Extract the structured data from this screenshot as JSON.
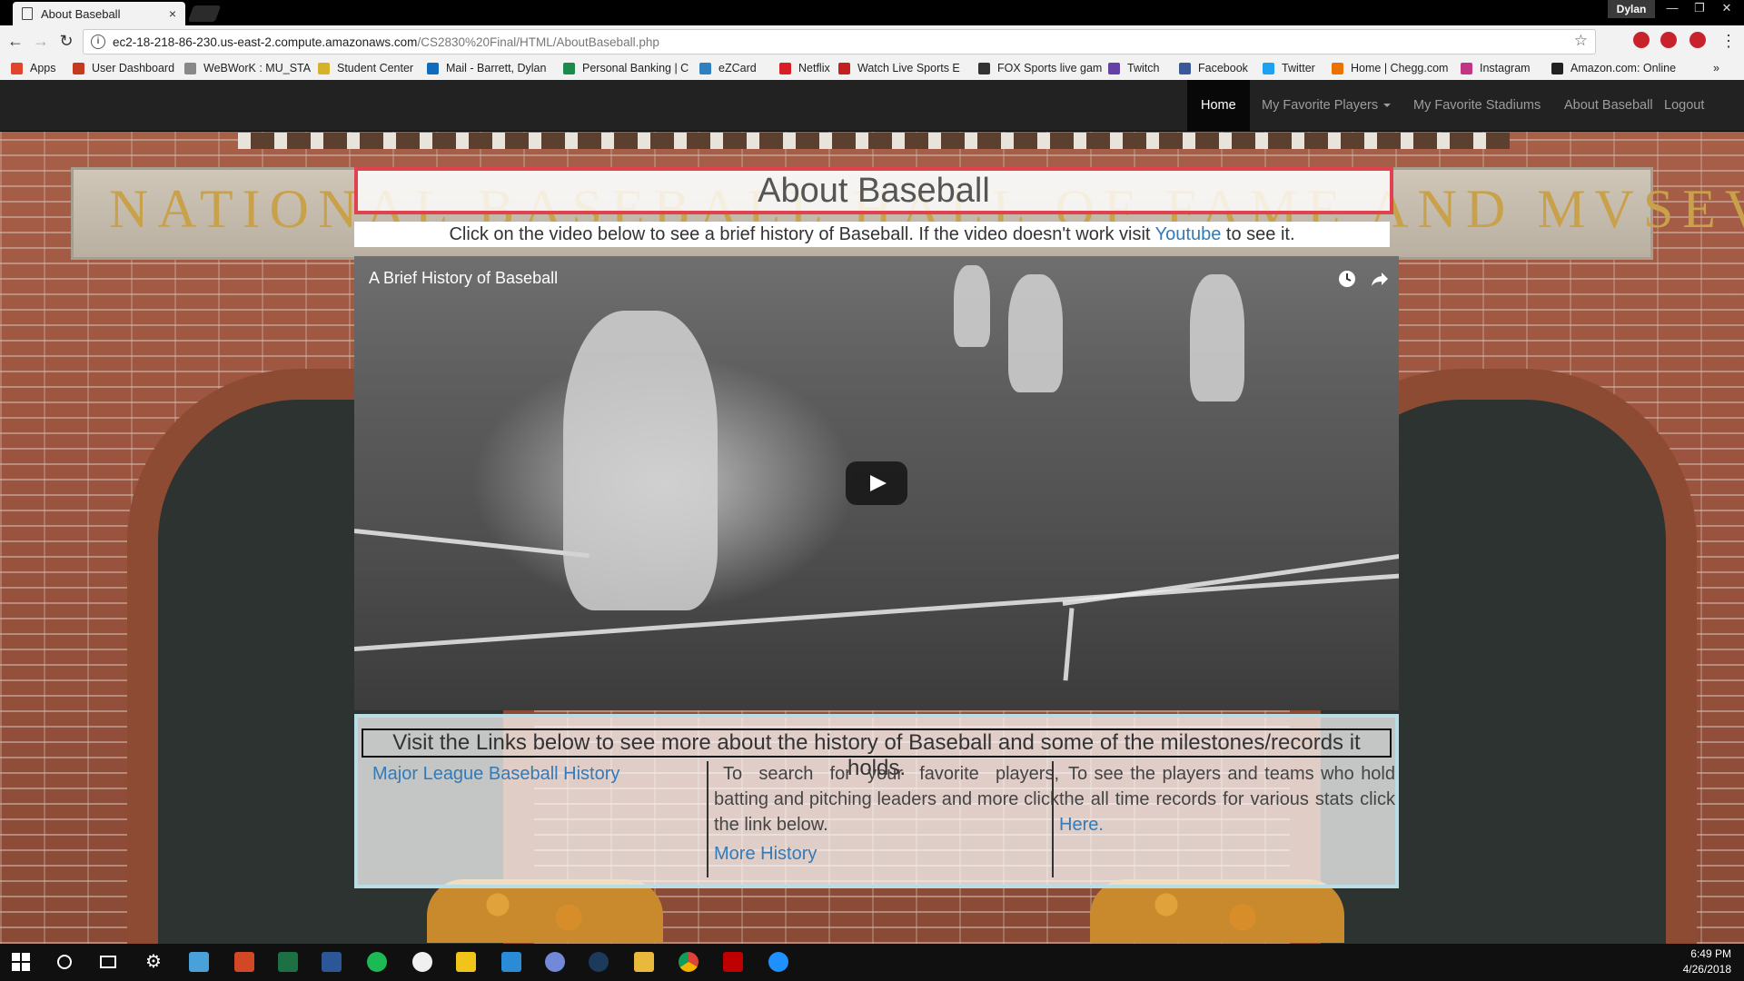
{
  "browser": {
    "tab_title": "About Baseball",
    "tab_close": "×",
    "user": "Dylan",
    "url_host": "ec2-18-218-86-230.us-east-2.compute.amazonaws.com",
    "url_path": "/CS2830%20Final/HTML/AboutBaseball.php",
    "bookmarks": [
      {
        "label": "Apps",
        "color": "#e0452b"
      },
      {
        "label": "User Dashboard",
        "color": "#c53a1f"
      },
      {
        "label": "WeBWorK : MU_STA",
        "color": "#888888"
      },
      {
        "label": "Student Center",
        "color": "#d6b12a"
      },
      {
        "label": "Mail - Barrett, Dylan",
        "color": "#0f6cbd"
      },
      {
        "label": "Personal Banking | C",
        "color": "#1b8a4a"
      },
      {
        "label": "eZCard",
        "color": "#2f7fc1"
      },
      {
        "label": "Netflix",
        "color": "#d81f26"
      },
      {
        "label": "Watch Live Sports E",
        "color": "#c41f1f"
      },
      {
        "label": "FOX Sports live gam",
        "color": "#333333"
      },
      {
        "label": "Twitch",
        "color": "#6441a5"
      },
      {
        "label": "Facebook",
        "color": "#3b5998"
      },
      {
        "label": "Twitter",
        "color": "#1da1f2"
      },
      {
        "label": "Home | Chegg.com",
        "color": "#eb7100"
      },
      {
        "label": "Instagram",
        "color": "#c13584"
      },
      {
        "label": "Amazon.com: Online",
        "color": "#222222"
      }
    ],
    "more_bookmarks": "»"
  },
  "navbar": {
    "items": [
      {
        "label": "Home"
      },
      {
        "label": "My Favorite Players"
      },
      {
        "label": "My Favorite Stadiums"
      },
      {
        "label": "About Baseball"
      },
      {
        "label": "Logout"
      }
    ]
  },
  "background": {
    "engraving": "NATIONAL BASEBALL HALL OF FAME AND MVSEVM"
  },
  "content": {
    "title": "About Baseball",
    "intro_before": "Click on the video below to see a brief history of Baseball. If the video doesn't work visit ",
    "intro_link": "Youtube",
    "intro_after": " to see it.",
    "video_title": "A Brief History of Baseball",
    "links_heading": "Visit the Links below to see more about the history of Baseball and some of the milestones/records it holds.",
    "col1_link": "Major League Baseball History",
    "col2_text": "To search for your favorite players, batting and pitching leaders and more click the link below.",
    "col2_link": "More History",
    "col3_text": "To see the players and teams who hold the all time records for various stats click ",
    "col3_link": "Here."
  },
  "taskbar": {
    "time": "6:49 PM",
    "date": "4/26/2018"
  }
}
